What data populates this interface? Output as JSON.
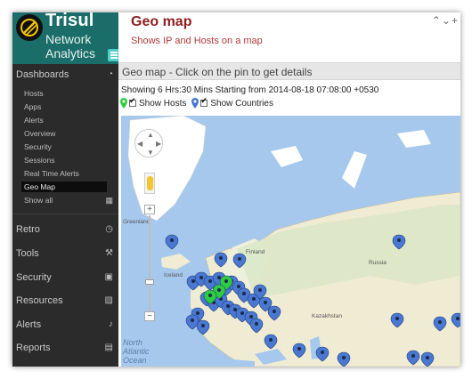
{
  "brand": {
    "name": "Trisul",
    "line1": "Network",
    "line2": "Analytics"
  },
  "sidebar": {
    "dashboards": {
      "label": "Dashboards",
      "items": [
        {
          "label": "Hosts"
        },
        {
          "label": "Apps"
        },
        {
          "label": "Alerts"
        },
        {
          "label": "Overview"
        },
        {
          "label": "Security"
        },
        {
          "label": "Sessions"
        },
        {
          "label": "Real Time Alerts"
        },
        {
          "label": "Geo Map"
        },
        {
          "label": "Show all"
        }
      ],
      "active": "Geo Map"
    },
    "sections": [
      {
        "label": "Retro",
        "icon": "clock-icon"
      },
      {
        "label": "Tools",
        "icon": "wrench-icon"
      },
      {
        "label": "Security",
        "icon": "lock-icon"
      },
      {
        "label": "Resources",
        "icon": "image-icon"
      },
      {
        "label": "Alerts",
        "icon": "bell-icon"
      },
      {
        "label": "Reports",
        "icon": "calendar-icon"
      }
    ]
  },
  "page": {
    "title": "Geo map",
    "subtitle": "Shows IP and Hosts on a map",
    "panel_title": "Geo map - Click on the pin to get details",
    "showing": "Showing 6 Hrs:30 Mins Starting from 2014-08-18 07:08:00 +0530",
    "show_hosts": "Show Hosts",
    "show_countries": "Show Countries"
  },
  "map": {
    "labels": {
      "greenland": "Greenland",
      "iceland": "Iceland",
      "finland": "Finland",
      "russia": "Russia",
      "kazakhstan": "Kazakhstan",
      "sea1": "North",
      "sea2": "Atlantic",
      "sea3": "Ocean"
    },
    "colors": {
      "land": "#f0ecd4",
      "land_north": "#ffffff",
      "water": "#a6c8ec",
      "pin": "#4a78d0",
      "pin_active": "#2ecc40"
    }
  }
}
